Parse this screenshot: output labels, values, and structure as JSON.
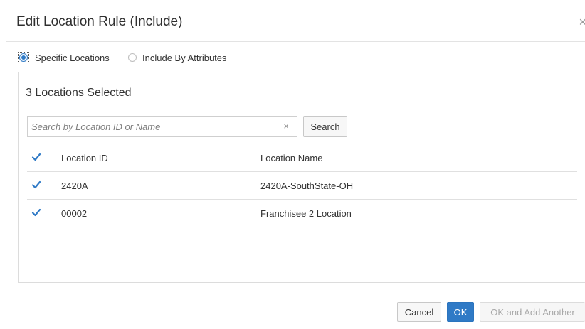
{
  "dialog": {
    "title": "Edit Location Rule (Include)",
    "close_glyph": "×",
    "close_icon": "close-icon"
  },
  "rule_type": {
    "options": [
      {
        "label": "Specific Locations",
        "selected": true
      },
      {
        "label": "Include By Attributes",
        "selected": false
      }
    ]
  },
  "selection": {
    "summary": "3 Locations Selected"
  },
  "search": {
    "placeholder": "Search by Location ID or Name",
    "value": "",
    "clear_glyph": "×",
    "button_label": "Search"
  },
  "table": {
    "headers": {
      "checked": true,
      "location_id": "Location ID",
      "location_name": "Location Name"
    },
    "rows": [
      {
        "checked": true,
        "location_id": "2420A",
        "location_name": "2420A-SouthState-OH"
      },
      {
        "checked": true,
        "location_id": "00002",
        "location_name": "Franchisee 2 Location"
      }
    ]
  },
  "footer": {
    "cancel_label": "Cancel",
    "ok_label": "OK",
    "ok_add_label": "OK and Add Another"
  },
  "colors": {
    "accent": "#2f7ac6",
    "disabled_text": "#a8a8a8"
  }
}
